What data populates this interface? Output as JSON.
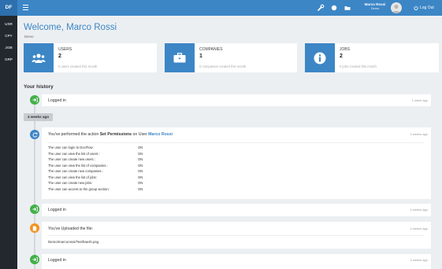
{
  "brand": "DF",
  "topbar": {
    "user_name": "Marco Rossi",
    "user_role": "Demo",
    "logout_label": "Log Out"
  },
  "sidebar": {
    "items": [
      {
        "label": "USR"
      },
      {
        "label": "CPY"
      },
      {
        "label": "JOB"
      },
      {
        "label": "GRP"
      }
    ]
  },
  "header": {
    "title": "Welcome, Marco Rossi",
    "subtitle": "Demo"
  },
  "stats": [
    {
      "label": "USERS",
      "value": "2",
      "note": "0 users created this month",
      "icon": "users-icon"
    },
    {
      "label": "COMPANIES",
      "value": "1",
      "note": "0 companies created this month",
      "icon": "briefcase-icon"
    },
    {
      "label": "JOBS",
      "value": "2",
      "note": "0 jobs created this month",
      "icon": "info-icon"
    }
  ],
  "history": {
    "title": "Your history",
    "date_badge": "4 weeks ago",
    "events": [
      {
        "text": "Logged in",
        "time": "1 week ago",
        "icon": "login-icon"
      },
      {
        "prefix": "You've performed the action ",
        "action": "Set Permissions",
        "mid": " on User ",
        "user": "Marco Rossi",
        "time": "4 weeks ago",
        "icon": "refresh-icon",
        "permissions": [
          {
            "label": "The user can login to DocFlow:",
            "value": "ON"
          },
          {
            "label": "The user can view the list of users.:",
            "value": "ON"
          },
          {
            "label": "The user can create new users.:",
            "value": "ON"
          },
          {
            "label": "The user can view the list of companies.:",
            "value": "ON"
          },
          {
            "label": "The user can create new companies.:",
            "value": "ON"
          },
          {
            "label": "The user can view the list of jobs:",
            "value": "ON"
          },
          {
            "label": "The user can create new jobs:",
            "value": "ON"
          },
          {
            "label": "The user can access to the group section:",
            "value": "ON"
          }
        ]
      },
      {
        "text": "Logged in",
        "time": "4 weeks ago",
        "icon": "login-icon"
      },
      {
        "text": "You've Uploaded the file:",
        "file": "Demo/marcorossi/Testfraesh.png",
        "time": "4 weeks ago",
        "icon": "upload-icon"
      },
      {
        "text": "Logged in",
        "time": "4 weeks ago",
        "icon": "login-icon"
      }
    ]
  },
  "colors": {
    "primary": "#3c86c6",
    "sidebar": "#22282e",
    "green": "#44b049",
    "orange": "#f39322"
  }
}
